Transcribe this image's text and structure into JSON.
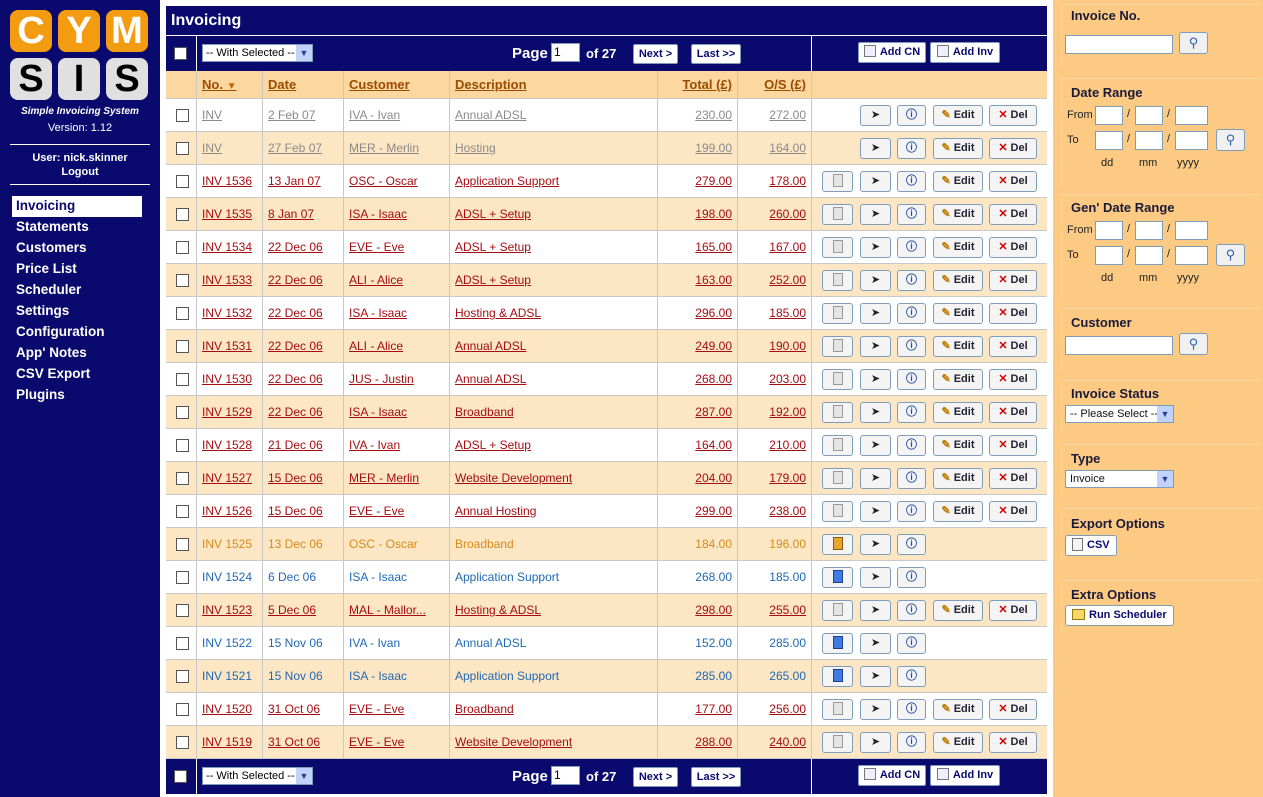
{
  "sidebar": {
    "logo_letters": [
      "C",
      "Y",
      "M",
      "S",
      "I",
      "S"
    ],
    "subtitle": "Simple Invoicing System",
    "version": "Version: 1.12",
    "user": "User: nick.skinner",
    "logout": "Logout",
    "nav": [
      "Invoicing",
      "Statements",
      "Customers",
      "Price List",
      "Scheduler",
      "Settings",
      "Configuration",
      "App' Notes",
      "CSV Export",
      "Plugins"
    ],
    "active_nav": "Invoicing"
  },
  "main": {
    "title": "Invoicing",
    "toolbar": {
      "with_selected": "-- With Selected --",
      "page_label": "Page",
      "page_value": "1",
      "of_label": "of 27",
      "next": "Next >",
      "last": "Last >>",
      "add_cn": "Add CN",
      "add_inv": "Add Inv"
    },
    "columns": [
      "No.",
      "Date",
      "Customer",
      "Description",
      "Total (£)",
      "O/S (£)"
    ],
    "sort_indicator": "▼",
    "actions": {
      "edit": "Edit",
      "del": "Del"
    },
    "rows": [
      {
        "no": "INV",
        "date": "2 Feb 07",
        "customer": "IVA - Ivan",
        "description": "Annual ADSL",
        "total": "230.00",
        "os": "272.00",
        "status": "grey",
        "buttons": [
          "send",
          "info",
          "edit",
          "del"
        ]
      },
      {
        "no": "INV",
        "date": "27 Feb 07",
        "customer": "MER - Merlin",
        "description": "Hosting",
        "total": "199.00",
        "os": "164.00",
        "status": "grey",
        "buttons": [
          "send",
          "info",
          "edit",
          "del"
        ]
      },
      {
        "no": "INV 1536",
        "date": "13 Jan 07",
        "customer": "OSC - Oscar",
        "description": "Application Support",
        "total": "279.00",
        "os": "178.00",
        "status": "red",
        "buttons": [
          "doc-grey",
          "send",
          "info",
          "edit",
          "del"
        ]
      },
      {
        "no": "INV 1535",
        "date": "8 Jan 07",
        "customer": "ISA - Isaac",
        "description": "ADSL + Setup",
        "total": "198.00",
        "os": "260.00",
        "status": "red",
        "buttons": [
          "doc-grey",
          "send",
          "info",
          "edit",
          "del"
        ]
      },
      {
        "no": "INV 1534",
        "date": "22 Dec 06",
        "customer": "EVE - Eve",
        "description": "ADSL + Setup",
        "total": "165.00",
        "os": "167.00",
        "status": "red",
        "buttons": [
          "doc-grey",
          "send",
          "info",
          "edit",
          "del"
        ]
      },
      {
        "no": "INV 1533",
        "date": "22 Dec 06",
        "customer": "ALI - Alice",
        "description": "ADSL + Setup",
        "total": "163.00",
        "os": "252.00",
        "status": "red",
        "buttons": [
          "doc-grey",
          "send",
          "info",
          "edit",
          "del"
        ]
      },
      {
        "no": "INV 1532",
        "date": "22 Dec 06",
        "customer": "ISA - Isaac",
        "description": "Hosting & ADSL",
        "total": "296.00",
        "os": "185.00",
        "status": "red",
        "buttons": [
          "doc-grey",
          "send",
          "info",
          "edit",
          "del"
        ]
      },
      {
        "no": "INV 1531",
        "date": "22 Dec 06",
        "customer": "ALI - Alice",
        "description": "Annual ADSL",
        "total": "249.00",
        "os": "190.00",
        "status": "red",
        "buttons": [
          "doc-grey",
          "send",
          "info",
          "edit",
          "del"
        ]
      },
      {
        "no": "INV 1530",
        "date": "22 Dec 06",
        "customer": "JUS - Justin",
        "description": "Annual ADSL",
        "total": "268.00",
        "os": "203.00",
        "status": "red",
        "buttons": [
          "doc-grey",
          "send",
          "info",
          "edit",
          "del"
        ]
      },
      {
        "no": "INV 1529",
        "date": "22 Dec 06",
        "customer": "ISA - Isaac",
        "description": "Broadband",
        "total": "287.00",
        "os": "192.00",
        "status": "red",
        "buttons": [
          "doc-grey",
          "send",
          "info",
          "edit",
          "del"
        ]
      },
      {
        "no": "INV 1528",
        "date": "21 Dec 06",
        "customer": "IVA - Ivan",
        "description": "ADSL + Setup",
        "total": "164.00",
        "os": "210.00",
        "status": "red",
        "buttons": [
          "doc-grey",
          "send",
          "info",
          "edit",
          "del"
        ]
      },
      {
        "no": "INV 1527",
        "date": "15 Dec 06",
        "customer": "MER - Merlin",
        "description": "Website Development",
        "total": "204.00",
        "os": "179.00",
        "status": "red",
        "buttons": [
          "doc-grey",
          "send",
          "info",
          "edit",
          "del"
        ]
      },
      {
        "no": "INV 1526",
        "date": "15 Dec 06",
        "customer": "EVE - Eve",
        "description": "Annual Hosting",
        "total": "299.00",
        "os": "238.00",
        "status": "red",
        "buttons": [
          "doc-grey",
          "send",
          "info",
          "edit",
          "del"
        ]
      },
      {
        "no": "INV 1525",
        "date": "13 Dec 06",
        "customer": "OSC - Oscar",
        "description": "Broadband",
        "total": "184.00",
        "os": "196.00",
        "status": "orange",
        "buttons": [
          "doc-orange",
          "send",
          "info"
        ]
      },
      {
        "no": "INV 1524",
        "date": "6 Dec 06",
        "customer": "ISA - Isaac",
        "description": "Application Support",
        "total": "268.00",
        "os": "185.00",
        "status": "blue",
        "buttons": [
          "doc-blue",
          "send",
          "info"
        ]
      },
      {
        "no": "INV 1523",
        "date": "5 Dec 06",
        "customer": "MAL - Mallor...",
        "description": "Hosting & ADSL",
        "total": "298.00",
        "os": "255.00",
        "status": "red",
        "buttons": [
          "doc-grey",
          "send",
          "info",
          "edit",
          "del"
        ]
      },
      {
        "no": "INV 1522",
        "date": "15 Nov 06",
        "customer": "IVA - Ivan",
        "description": "Annual ADSL",
        "total": "152.00",
        "os": "285.00",
        "status": "blue",
        "buttons": [
          "doc-blue",
          "send",
          "info"
        ]
      },
      {
        "no": "INV 1521",
        "date": "15 Nov 06",
        "customer": "ISA - Isaac",
        "description": "Application Support",
        "total": "285.00",
        "os": "265.00",
        "status": "blue",
        "buttons": [
          "doc-blue",
          "send",
          "info"
        ]
      },
      {
        "no": "INV 1520",
        "date": "31 Oct 06",
        "customer": "EVE - Eve",
        "description": "Broadband",
        "total": "177.00",
        "os": "256.00",
        "status": "red",
        "buttons": [
          "doc-grey",
          "send",
          "info",
          "edit",
          "del"
        ]
      },
      {
        "no": "INV 1519",
        "date": "31 Oct 06",
        "customer": "EVE - Eve",
        "description": "Website Development",
        "total": "288.00",
        "os": "240.00",
        "status": "red",
        "buttons": [
          "doc-grey",
          "send",
          "info",
          "edit",
          "del"
        ]
      }
    ]
  },
  "filters": {
    "invoice_no_label": "Invoice No.",
    "date_range_label": "Date Range",
    "gen_date_range_label": "Gen' Date Range",
    "from": "From",
    "to": "To",
    "dd": "dd",
    "mm": "mm",
    "yyyy": "yyyy",
    "slash": "/",
    "customer_label": "Customer",
    "status_label": "Invoice Status",
    "status_value": "-- Please Select --",
    "type_label": "Type",
    "type_value": "Invoice",
    "export_label": "Export Options",
    "csv_button": "CSV",
    "extra_label": "Extra Options",
    "scheduler_button": "Run Scheduler"
  },
  "colors": {
    "navy": "#0a0a6e",
    "orange_panel": "#fcca82",
    "row_alt": "#fde6c3",
    "header": "#fcd7a0",
    "text_red": "#a50d12",
    "text_blue": "#1f68b5",
    "text_orange": "#d68b1c",
    "text_grey": "#8a8a8a"
  }
}
